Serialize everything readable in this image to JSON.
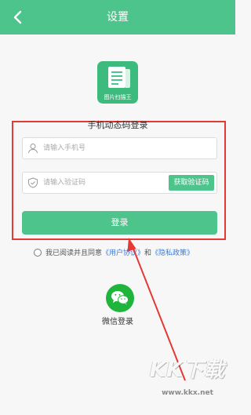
{
  "header": {
    "back_icon": "chevron-left-icon",
    "title": "设置"
  },
  "logo": {
    "caption": "图片扫描王"
  },
  "login": {
    "title": "手机动态码登录",
    "phone_placeholder": "请输入手机号",
    "code_placeholder": "请输入验证码",
    "get_code_label": "获取验证码",
    "submit_label": "登录"
  },
  "agreement": {
    "prefix": "我已阅读并且同意",
    "user_agreement": "《用户协议》",
    "conjunction": "和",
    "privacy_policy": "《隐私政策》"
  },
  "wechat": {
    "icon": "wechat-icon",
    "label": "微信登录"
  },
  "watermark": {
    "brand": "KK下载",
    "url": "www.kkx.net"
  },
  "colors": {
    "brand_green": "#4cc48b",
    "highlight_red": "#e53935",
    "link_blue": "#3b7dd8",
    "wechat_green": "#1fb53d"
  }
}
